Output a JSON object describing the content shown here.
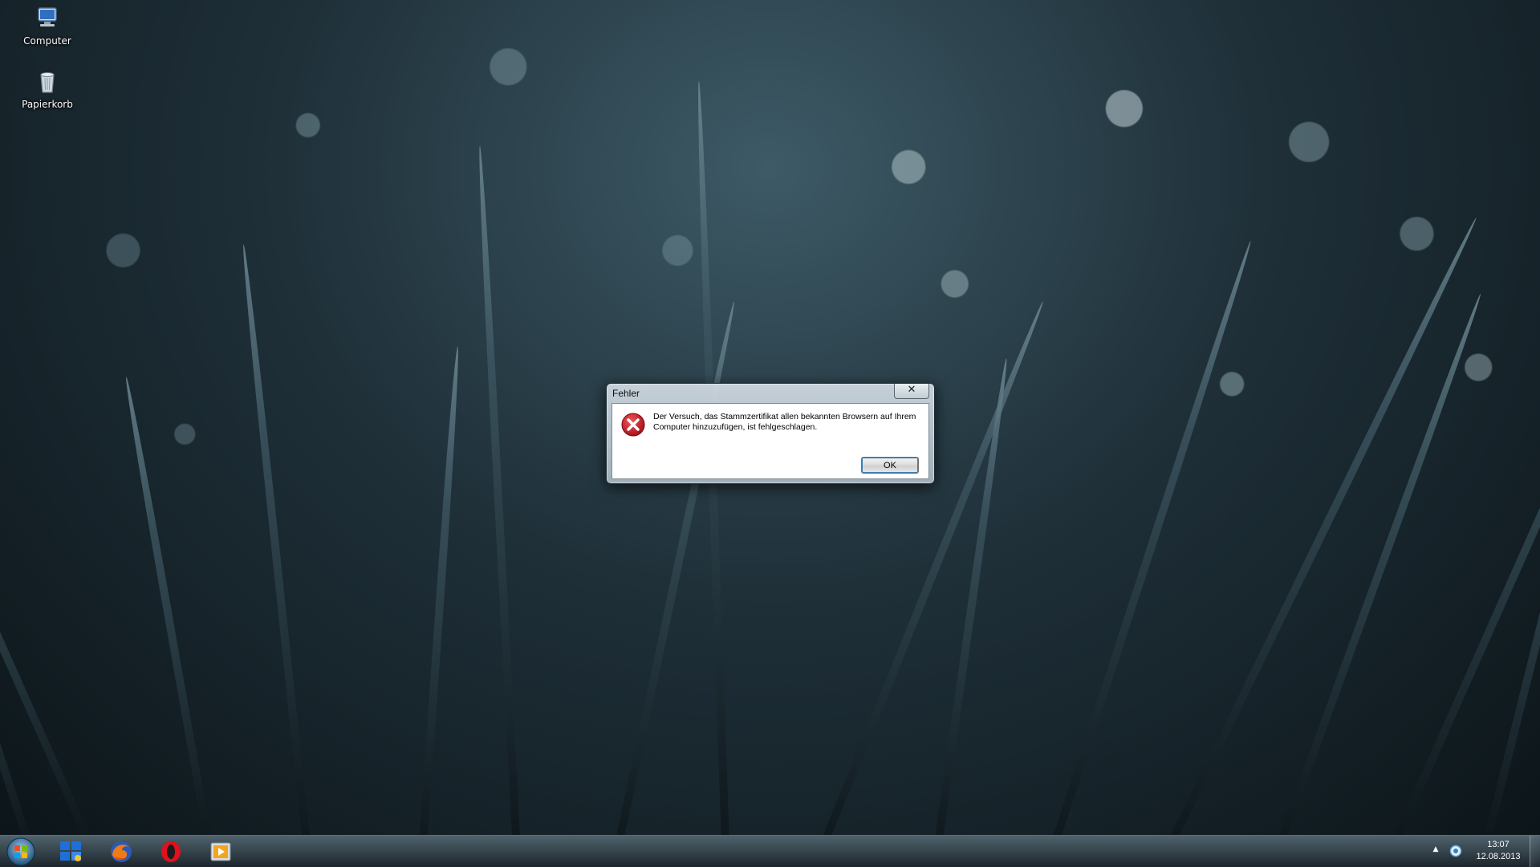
{
  "desktop": {
    "icons": [
      {
        "label": "Computer",
        "icon": "computer-icon"
      },
      {
        "label": "Papierkorb",
        "icon": "recycle-bin-icon"
      }
    ]
  },
  "dialog": {
    "title": "Fehler",
    "close_label": "✕",
    "icon": "error-icon",
    "message": "Der Versuch, das Stammzertifikat allen bekannten Browsern auf Ihrem Computer hinzuzufügen, ist fehlgeschlagen.",
    "ok_label": "OK",
    "error_color": "#c8171e"
  },
  "taskbar": {
    "start_icon": "windows-start-icon",
    "apps": [
      {
        "name": "start-menu-tiles-icon"
      },
      {
        "name": "firefox-icon"
      },
      {
        "name": "opera-icon"
      },
      {
        "name": "media-player-icon"
      }
    ],
    "tray": {
      "arrow": "▲",
      "network_icon": "network-icon"
    },
    "clock": {
      "time": "13:07",
      "date": "12.08.2013"
    }
  }
}
